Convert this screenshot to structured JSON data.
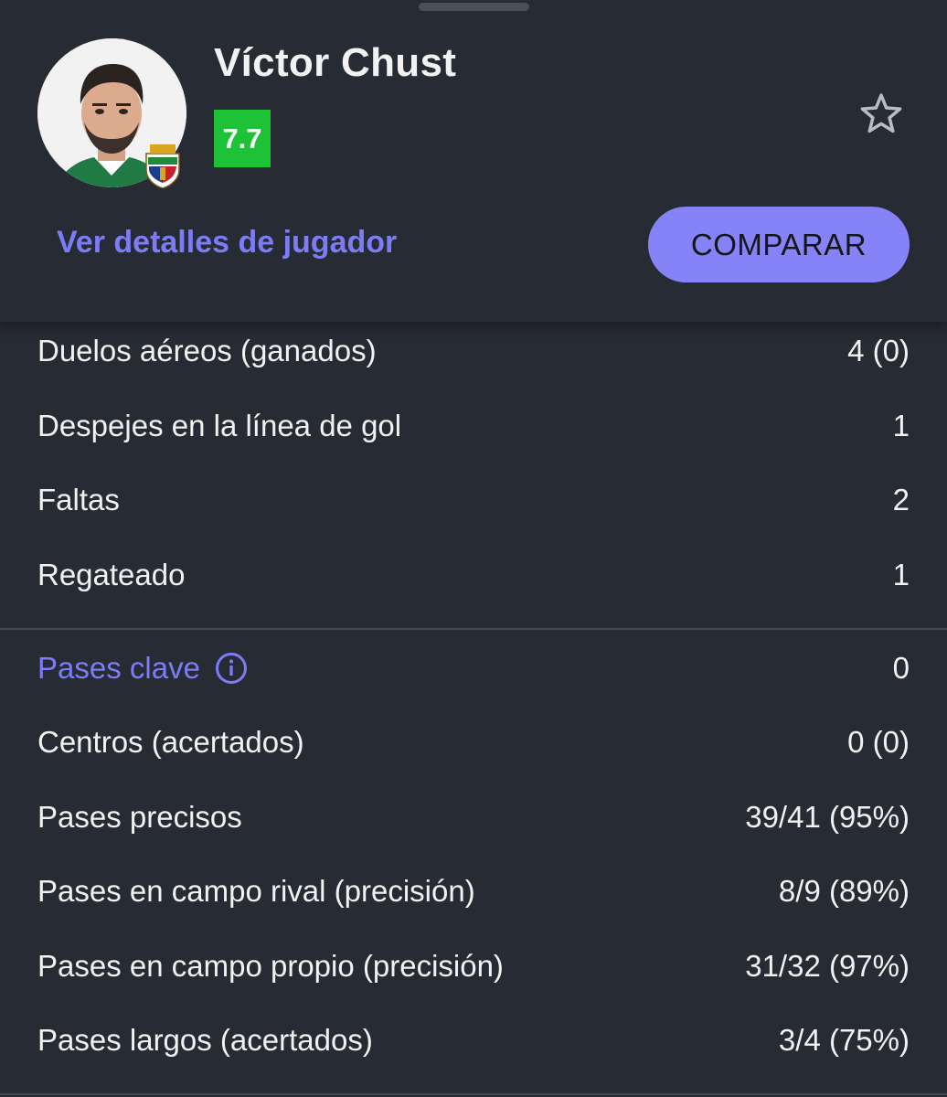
{
  "player": {
    "name": "Víctor Chust",
    "rating": "7.7",
    "rating_color": "#1ec236"
  },
  "actions": {
    "details_link": "Ver detalles de jugador",
    "compare_button": "COMPARAR"
  },
  "icons": {
    "favorite": "star-outline-icon",
    "info": "info-circle-icon",
    "club": "elche-club-badge"
  },
  "stats_group_1": [
    {
      "label": "Duelos aéreos (ganados)",
      "value": "4 (0)"
    },
    {
      "label": "Despejes en la línea de gol",
      "value": "1"
    },
    {
      "label": "Faltas",
      "value": "2"
    },
    {
      "label": "Regateado",
      "value": "1"
    }
  ],
  "stats_group_2": [
    {
      "label": "Pases clave",
      "value": "0"
    },
    {
      "label": "Centros (acertados)",
      "value": "0 (0)"
    },
    {
      "label": "Pases precisos",
      "value": "39/41 (95%)"
    },
    {
      "label": "Pases en campo rival (precisión)",
      "value": "8/9 (89%)"
    },
    {
      "label": "Pases en campo propio (precisión)",
      "value": "31/32 (97%)"
    },
    {
      "label": "Pases largos (acertados)",
      "value": "3/4 (75%)"
    }
  ],
  "colors": {
    "background": "#272b33",
    "accent": "#8583f7",
    "link": "#7d7cf7"
  }
}
